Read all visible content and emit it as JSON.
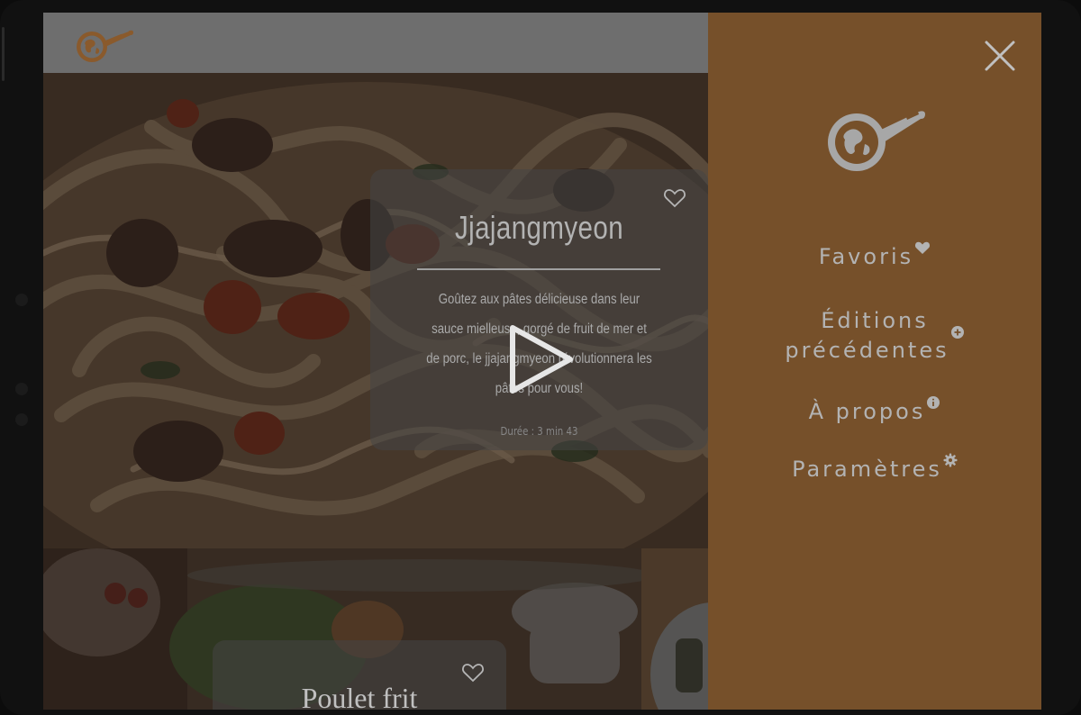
{
  "featured": {
    "title": "Jjajangmyeon",
    "description": "Goûtez aux pâtes délicieuse dans leur sauce mielleuse, gorgé de fruit de mer et de porc, le jjajangmyeon révolutionnera les pâtes pour vous!",
    "duration": "Durée : 3 min 43"
  },
  "second_card": {
    "title": "Poulet frit"
  },
  "menu": {
    "items": [
      {
        "label": "Favoris",
        "icon": "heart-icon"
      },
      {
        "label_line1": "Éditions",
        "label_line2": "précédentes",
        "icon": "plus-circle-icon"
      },
      {
        "label": "À propos",
        "icon": "info-icon"
      },
      {
        "label": "Paramètres",
        "icon": "gear-icon"
      }
    ]
  },
  "colors": {
    "menu_background": "#76502a",
    "menu_text": "#b3b3b3",
    "logo_brown": "#8a5a2c"
  }
}
